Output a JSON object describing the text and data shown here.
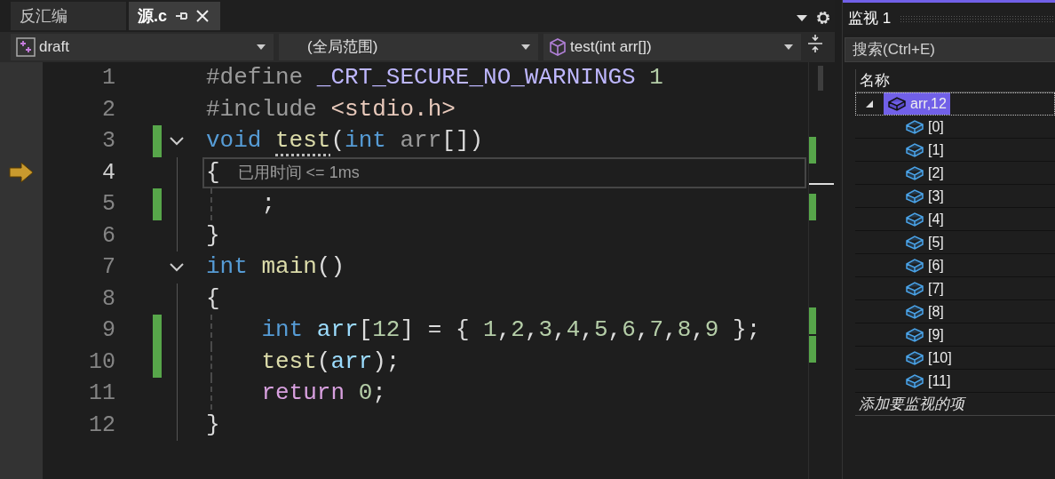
{
  "tabs": [
    {
      "label": "反汇编",
      "selected": false
    },
    {
      "label": "源.c",
      "selected": true
    }
  ],
  "nav": {
    "project": "draft",
    "scope": "(全局范围)",
    "member": "test(int arr[])"
  },
  "code": {
    "lines": [
      {
        "number": "1",
        "changed": false,
        "current": false,
        "in_block": false,
        "tokens": [
          {
            "kind": "preproc",
            "text": "#define "
          },
          {
            "kind": "macro",
            "text": "_CRT_SECURE_NO_WARNINGS "
          },
          {
            "kind": "number",
            "text": "1"
          }
        ]
      },
      {
        "number": "2",
        "changed": false,
        "current": false,
        "in_block": false,
        "tokens": [
          {
            "kind": "preproc",
            "text": "#include "
          },
          {
            "kind": "header",
            "text": "<stdio.h>"
          }
        ]
      },
      {
        "number": "3",
        "changed": true,
        "current": false,
        "in_block": false,
        "expanded": true,
        "tokens": [
          {
            "kind": "keyword",
            "text": "void "
          },
          {
            "kind": "function",
            "text": "test",
            "hinted": true
          },
          {
            "kind": "plain",
            "text": "("
          },
          {
            "kind": "keyword",
            "text": "int "
          },
          {
            "kind": "param",
            "text": "arr"
          },
          {
            "kind": "plain",
            "text": "[])"
          }
        ]
      },
      {
        "number": "4",
        "changed": false,
        "current": true,
        "in_block": true,
        "hint": "已用时间 <= 1ms",
        "tokens": [
          {
            "kind": "plain",
            "text": "{"
          }
        ]
      },
      {
        "number": "5",
        "changed": true,
        "current": false,
        "in_block": true,
        "tokens": [
          {
            "kind": "plain",
            "text": "    ;"
          }
        ]
      },
      {
        "number": "6",
        "changed": false,
        "current": false,
        "in_block": true,
        "tokens": [
          {
            "kind": "plain",
            "text": "}"
          }
        ]
      },
      {
        "number": "7",
        "changed": false,
        "current": false,
        "in_block": false,
        "expanded": true,
        "tokens": [
          {
            "kind": "keyword",
            "text": "int "
          },
          {
            "kind": "function",
            "text": "main"
          },
          {
            "kind": "plain",
            "text": "()"
          }
        ]
      },
      {
        "number": "8",
        "changed": false,
        "current": false,
        "in_block": true,
        "tokens": [
          {
            "kind": "plain",
            "text": "{"
          }
        ]
      },
      {
        "number": "9",
        "changed": true,
        "current": false,
        "in_block": true,
        "tokens": [
          {
            "kind": "keyword",
            "text": "    int "
          },
          {
            "kind": "local",
            "text": "arr"
          },
          {
            "kind": "plain",
            "text": "["
          },
          {
            "kind": "number",
            "text": "12"
          },
          {
            "kind": "plain",
            "text": "] = { "
          },
          {
            "kind": "number",
            "text": "1"
          },
          {
            "kind": "plain",
            "text": ","
          },
          {
            "kind": "number",
            "text": "2"
          },
          {
            "kind": "plain",
            "text": ","
          },
          {
            "kind": "number",
            "text": "3"
          },
          {
            "kind": "plain",
            "text": ","
          },
          {
            "kind": "number",
            "text": "4"
          },
          {
            "kind": "plain",
            "text": ","
          },
          {
            "kind": "number",
            "text": "5"
          },
          {
            "kind": "plain",
            "text": ","
          },
          {
            "kind": "number",
            "text": "6"
          },
          {
            "kind": "plain",
            "text": ","
          },
          {
            "kind": "number",
            "text": "7"
          },
          {
            "kind": "plain",
            "text": ","
          },
          {
            "kind": "number",
            "text": "8"
          },
          {
            "kind": "plain",
            "text": ","
          },
          {
            "kind": "number",
            "text": "9"
          },
          {
            "kind": "plain",
            "text": " };"
          }
        ]
      },
      {
        "number": "10",
        "changed": true,
        "current": false,
        "in_block": true,
        "tokens": [
          {
            "kind": "function",
            "text": "    test"
          },
          {
            "kind": "plain",
            "text": "("
          },
          {
            "kind": "local",
            "text": "arr"
          },
          {
            "kind": "plain",
            "text": ");"
          }
        ]
      },
      {
        "number": "11",
        "changed": false,
        "current": false,
        "in_block": true,
        "tokens": [
          {
            "kind": "control",
            "text": "    return "
          },
          {
            "kind": "number",
            "text": "0"
          },
          {
            "kind": "plain",
            "text": ";"
          }
        ]
      },
      {
        "number": "12",
        "changed": false,
        "current": false,
        "in_block": true,
        "tokens": [
          {
            "kind": "plain",
            "text": "}"
          }
        ]
      }
    ]
  },
  "watch": {
    "title": "监视 1",
    "search": {
      "placeholder": "搜索(Ctrl+E)"
    },
    "columns": [
      "名称"
    ],
    "items": [
      {
        "name": "arr,12",
        "selected": true,
        "expanded": true,
        "children": [
          {
            "name": "[0]",
            "selected": false
          },
          {
            "name": "[1]",
            "selected": false
          },
          {
            "name": "[2]",
            "selected": false
          },
          {
            "name": "[3]",
            "selected": false
          },
          {
            "name": "[4]",
            "selected": false
          },
          {
            "name": "[5]",
            "selected": false
          },
          {
            "name": "[6]",
            "selected": false
          },
          {
            "name": "[7]",
            "selected": false
          },
          {
            "name": "[8]",
            "selected": false
          },
          {
            "name": "[9]",
            "selected": false
          },
          {
            "name": "[10]",
            "selected": false
          },
          {
            "name": "[11]",
            "selected": false
          }
        ]
      }
    ],
    "add_prompt": "添加要监视的项"
  }
}
